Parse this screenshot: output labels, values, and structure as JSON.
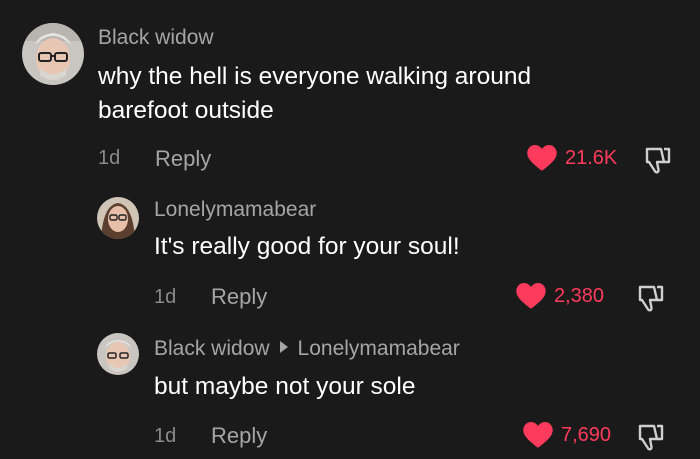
{
  "colors": {
    "background": "#1a1a1a",
    "username": "#a5a5a5",
    "body_text": "#ffffff",
    "meta": "#8a8a8a",
    "like_accent": "#fe3b5c"
  },
  "comments": [
    {
      "username": "Black widow",
      "text": "why the hell is everyone walking around barefoot outside",
      "time": "1d",
      "reply_label": "Reply",
      "likes": "21.6K",
      "like_icon": "heart-icon",
      "dislike_icon": "thumbs-down-icon"
    },
    {
      "username": "Lonelymamabear",
      "text": "It's really good for your soul!",
      "time": "1d",
      "reply_label": "Reply",
      "likes": "2,380",
      "like_icon": "heart-icon",
      "dislike_icon": "thumbs-down-icon"
    },
    {
      "username": "Black widow",
      "reply_to": "Lonelymamabear",
      "text": "but maybe not your sole",
      "time": "1d",
      "reply_label": "Reply",
      "likes": "7,690",
      "like_icon": "heart-icon",
      "dislike_icon": "thumbs-down-icon"
    }
  ]
}
